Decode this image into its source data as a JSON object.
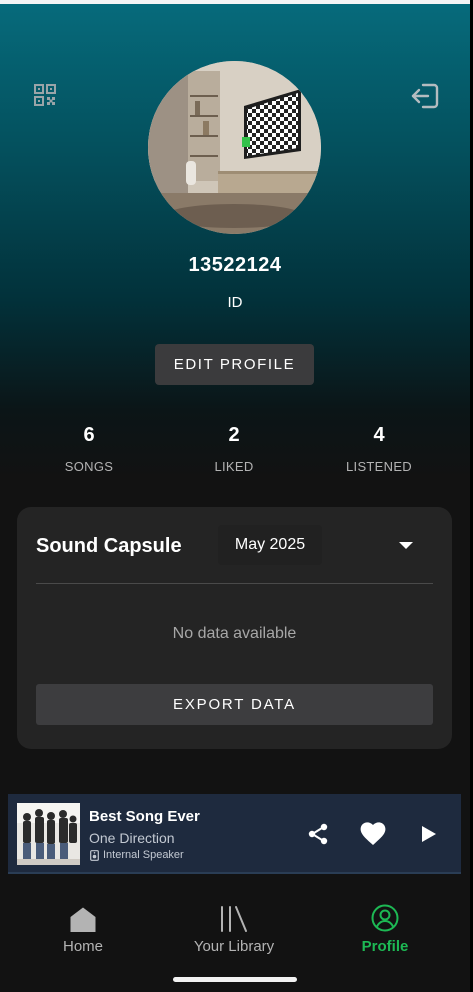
{
  "profile": {
    "username": "13522124",
    "user_id_label": "ID",
    "edit_button": "EDIT PROFILE",
    "qr_icon": "qr-code-icon",
    "logout_icon": "logout-icon"
  },
  "stats": [
    {
      "value": "6",
      "label": "SONGS"
    },
    {
      "value": "2",
      "label": "LIKED"
    },
    {
      "value": "4",
      "label": "LISTENED"
    }
  ],
  "sound_capsule": {
    "title": "Sound Capsule",
    "selected_month": "May 2025",
    "empty_message": "No data available",
    "export_button": "EXPORT DATA"
  },
  "now_playing": {
    "title": "Best Song Ever",
    "artist": "One Direction",
    "device": "Internal Speaker",
    "liked": true
  },
  "nav": {
    "items": [
      {
        "label": "Home",
        "icon": "home-icon"
      },
      {
        "label": "Your Library",
        "icon": "library-icon"
      },
      {
        "label": "Profile",
        "icon": "profile-icon"
      }
    ],
    "active": "Profile"
  },
  "colors": {
    "accent": "#1db954",
    "gradient_top": "#066b7c",
    "background": "#121212",
    "card": "#242424",
    "player": "#1e2a3e"
  }
}
